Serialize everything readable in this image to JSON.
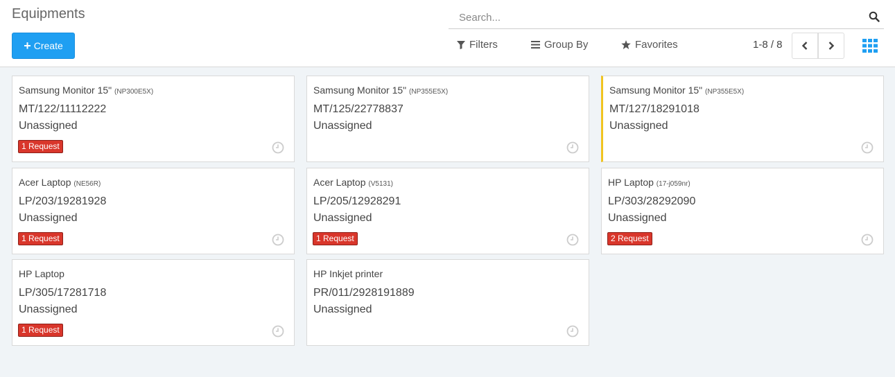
{
  "page": {
    "title": "Equipments"
  },
  "toolbar": {
    "create_label": "Create",
    "search_placeholder": "Search...",
    "filters_label": "Filters",
    "groupby_label": "Group By",
    "favorites_label": "Favorites",
    "pager_value": "1-8 / 8"
  },
  "colors": {
    "primary": "#1f9ff2",
    "badge": "#d9362b",
    "accent": "#f0c420"
  },
  "cards": [
    {
      "name": "Samsung Monitor 15\"",
      "model": "(NP300E5X)",
      "serial": "MT/122/11112222",
      "owner": "Unassigned",
      "badge": "1 Request"
    },
    {
      "name": "Samsung Monitor 15\"",
      "model": "(NP355E5X)",
      "serial": "MT/125/22778837",
      "owner": "Unassigned",
      "badge": ""
    },
    {
      "name": "Samsung Monitor 15\"",
      "model": "(NP355E5X)",
      "serial": "MT/127/18291018",
      "owner": "Unassigned",
      "badge": ""
    },
    {
      "name": "Acer Laptop",
      "model": "(NE56R)",
      "serial": "LP/203/19281928",
      "owner": "Unassigned",
      "badge": "1 Request"
    },
    {
      "name": "Acer Laptop",
      "model": "(V5131)",
      "serial": "LP/205/12928291",
      "owner": "Unassigned",
      "badge": "1 Request"
    },
    {
      "name": "HP Laptop",
      "model": "(17-j059nr)",
      "serial": "LP/303/28292090",
      "owner": "Unassigned",
      "badge": "2 Request"
    },
    {
      "name": "HP Laptop",
      "model": "",
      "serial": "LP/305/17281718",
      "owner": "Unassigned",
      "badge": "1 Request"
    },
    {
      "name": "HP Inkjet printer",
      "model": "",
      "serial": "PR/011/2928191889",
      "owner": "Unassigned",
      "badge": ""
    }
  ]
}
